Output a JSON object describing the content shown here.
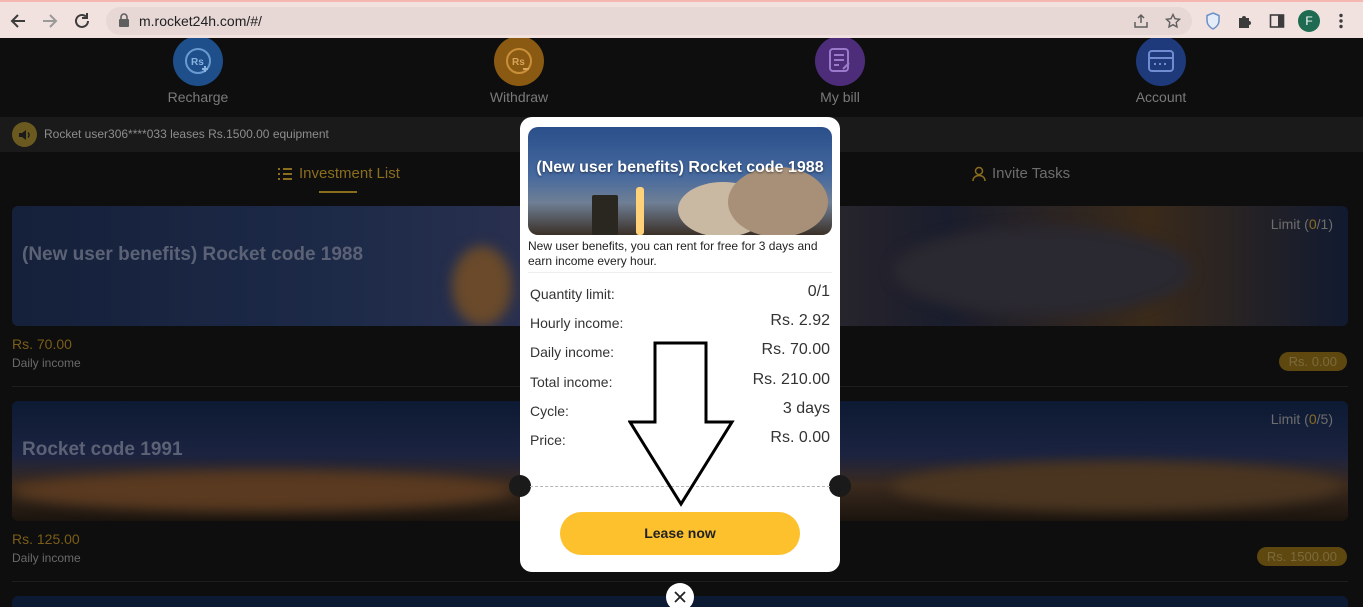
{
  "browser": {
    "url": "m.rocket24h.com/#/",
    "profile_initial": "F"
  },
  "quick_menu": [
    {
      "label": "Recharge",
      "icon": "recharge-icon",
      "color": "#1e4f8a"
    },
    {
      "label": "Withdraw",
      "icon": "withdraw-icon",
      "color": "#8a5a12"
    },
    {
      "label": "My bill",
      "icon": "bill-icon",
      "color": "#4d2d7a"
    },
    {
      "label": "Account",
      "icon": "account-icon",
      "color": "#1e3a7a"
    }
  ],
  "notice": {
    "text": "Rocket user306****033 leases Rs.1500.00 equipment"
  },
  "tabs": {
    "investment": "Investment List",
    "invite": "Invite Tasks"
  },
  "products": [
    {
      "title": "(New user benefits) Rocket code 1988",
      "limit_prefix": "Limit (",
      "limit_value": "0",
      "limit_suffix": "/1)",
      "daily_value": "Rs. 70.00",
      "daily_label": "Daily income",
      "price_badge": "Rs. 0.00"
    },
    {
      "title": "Rocket code 1991",
      "limit_prefix": "Limit (",
      "limit_value": "0",
      "limit_suffix": "/5)",
      "daily_value": "Rs. 125.00",
      "daily_label": "Daily income",
      "price_badge": "Rs. 1500.00"
    }
  ],
  "modal": {
    "banner_title": "(New user benefits) Rocket code 1988",
    "description": "New user benefits, you can rent for free for 3 days and earn income every hour.",
    "rows": [
      {
        "label": "Quantity limit:",
        "value": "0/1"
      },
      {
        "label": "Hourly income:",
        "value": "Rs. 2.92"
      },
      {
        "label": "Daily income:",
        "value": "Rs. 70.00"
      },
      {
        "label": "Total income:",
        "value": "Rs. 210.00"
      },
      {
        "label": "Cycle:",
        "value": "3 days"
      },
      {
        "label": "Price:",
        "value": "Rs. 0.00"
      }
    ],
    "button": "Lease now"
  },
  "colors": {
    "accent": "#fcc12c",
    "dim_gold": "#8a6d1d"
  }
}
